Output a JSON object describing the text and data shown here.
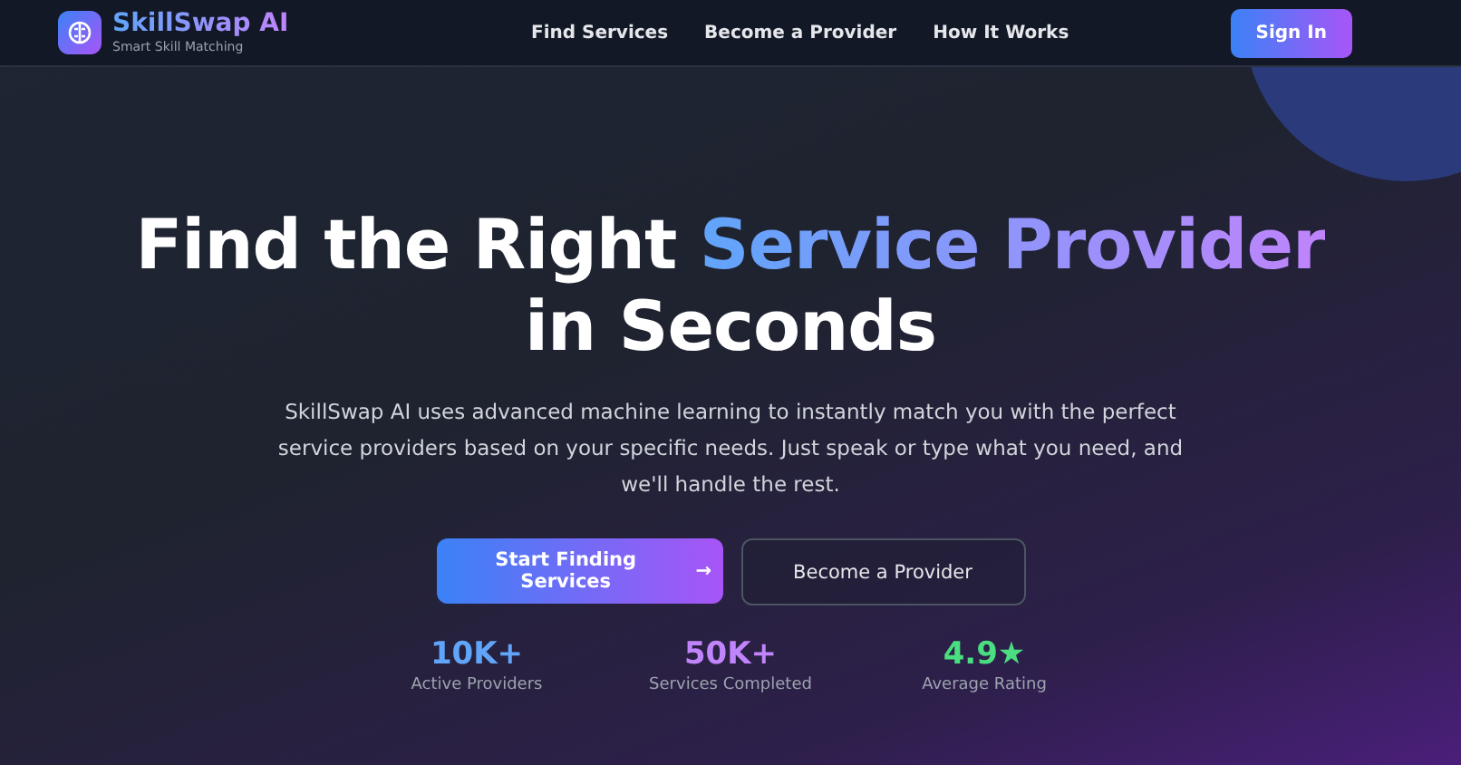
{
  "brand": {
    "name": "SkillSwap AI",
    "tagline": "Smart Skill Matching"
  },
  "nav": [
    {
      "label": "Find Services"
    },
    {
      "label": "Become a Provider"
    },
    {
      "label": "How It Works"
    }
  ],
  "sign_in": "Sign In",
  "hero": {
    "title_start": "Find the Right ",
    "title_highlight": "Service Provider",
    "title_end": "in Seconds",
    "description": "SkillSwap AI uses advanced machine learning to instantly match you with the perfect service providers based on your specific needs. Just speak or type what you need, and we'll handle the rest.",
    "primary_button": {
      "label": "Start Finding Services",
      "icon": "→"
    },
    "secondary_button": "Become a Provider"
  },
  "stats": [
    {
      "value": "10K+",
      "label": "Active Providers",
      "color": "#60a5fa"
    },
    {
      "value": "50K+",
      "label": "Services Completed",
      "color": "#c084fc"
    },
    {
      "value": "4.9★",
      "label": "Average Rating",
      "color": "#4ade80"
    }
  ]
}
